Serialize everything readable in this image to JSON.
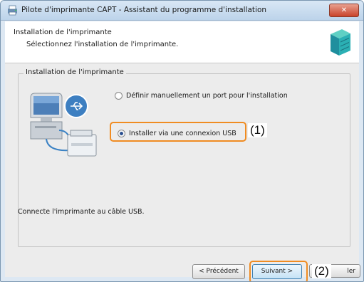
{
  "window": {
    "title": "Pilote d'imprimante CAPT - Assistant du programme d'installation",
    "close_label": "✕"
  },
  "header": {
    "title": "Installation de l'imprimante",
    "subtitle": "Sélectionnez l'installation de l'imprimante."
  },
  "group": {
    "label": "Installation de l'imprimante",
    "options": [
      {
        "label": "Définir manuellement un port pour l'installation",
        "selected": false
      },
      {
        "label": "Installer via une connexion USB",
        "selected": true
      }
    ],
    "description": "Connecte l'imprimante au câble USB."
  },
  "buttons": {
    "previous": "< Précédent",
    "next": "Suivant >",
    "cancel": "ler"
  },
  "callouts": {
    "one": "(1)",
    "two": "(2)"
  },
  "colors": {
    "highlight": "#f08c22",
    "accent": "#2a4f8f"
  },
  "icons": {
    "app": "printer-installer-icon",
    "header": "server-box-icon",
    "illustration": "computer-usb-printer-icon"
  }
}
